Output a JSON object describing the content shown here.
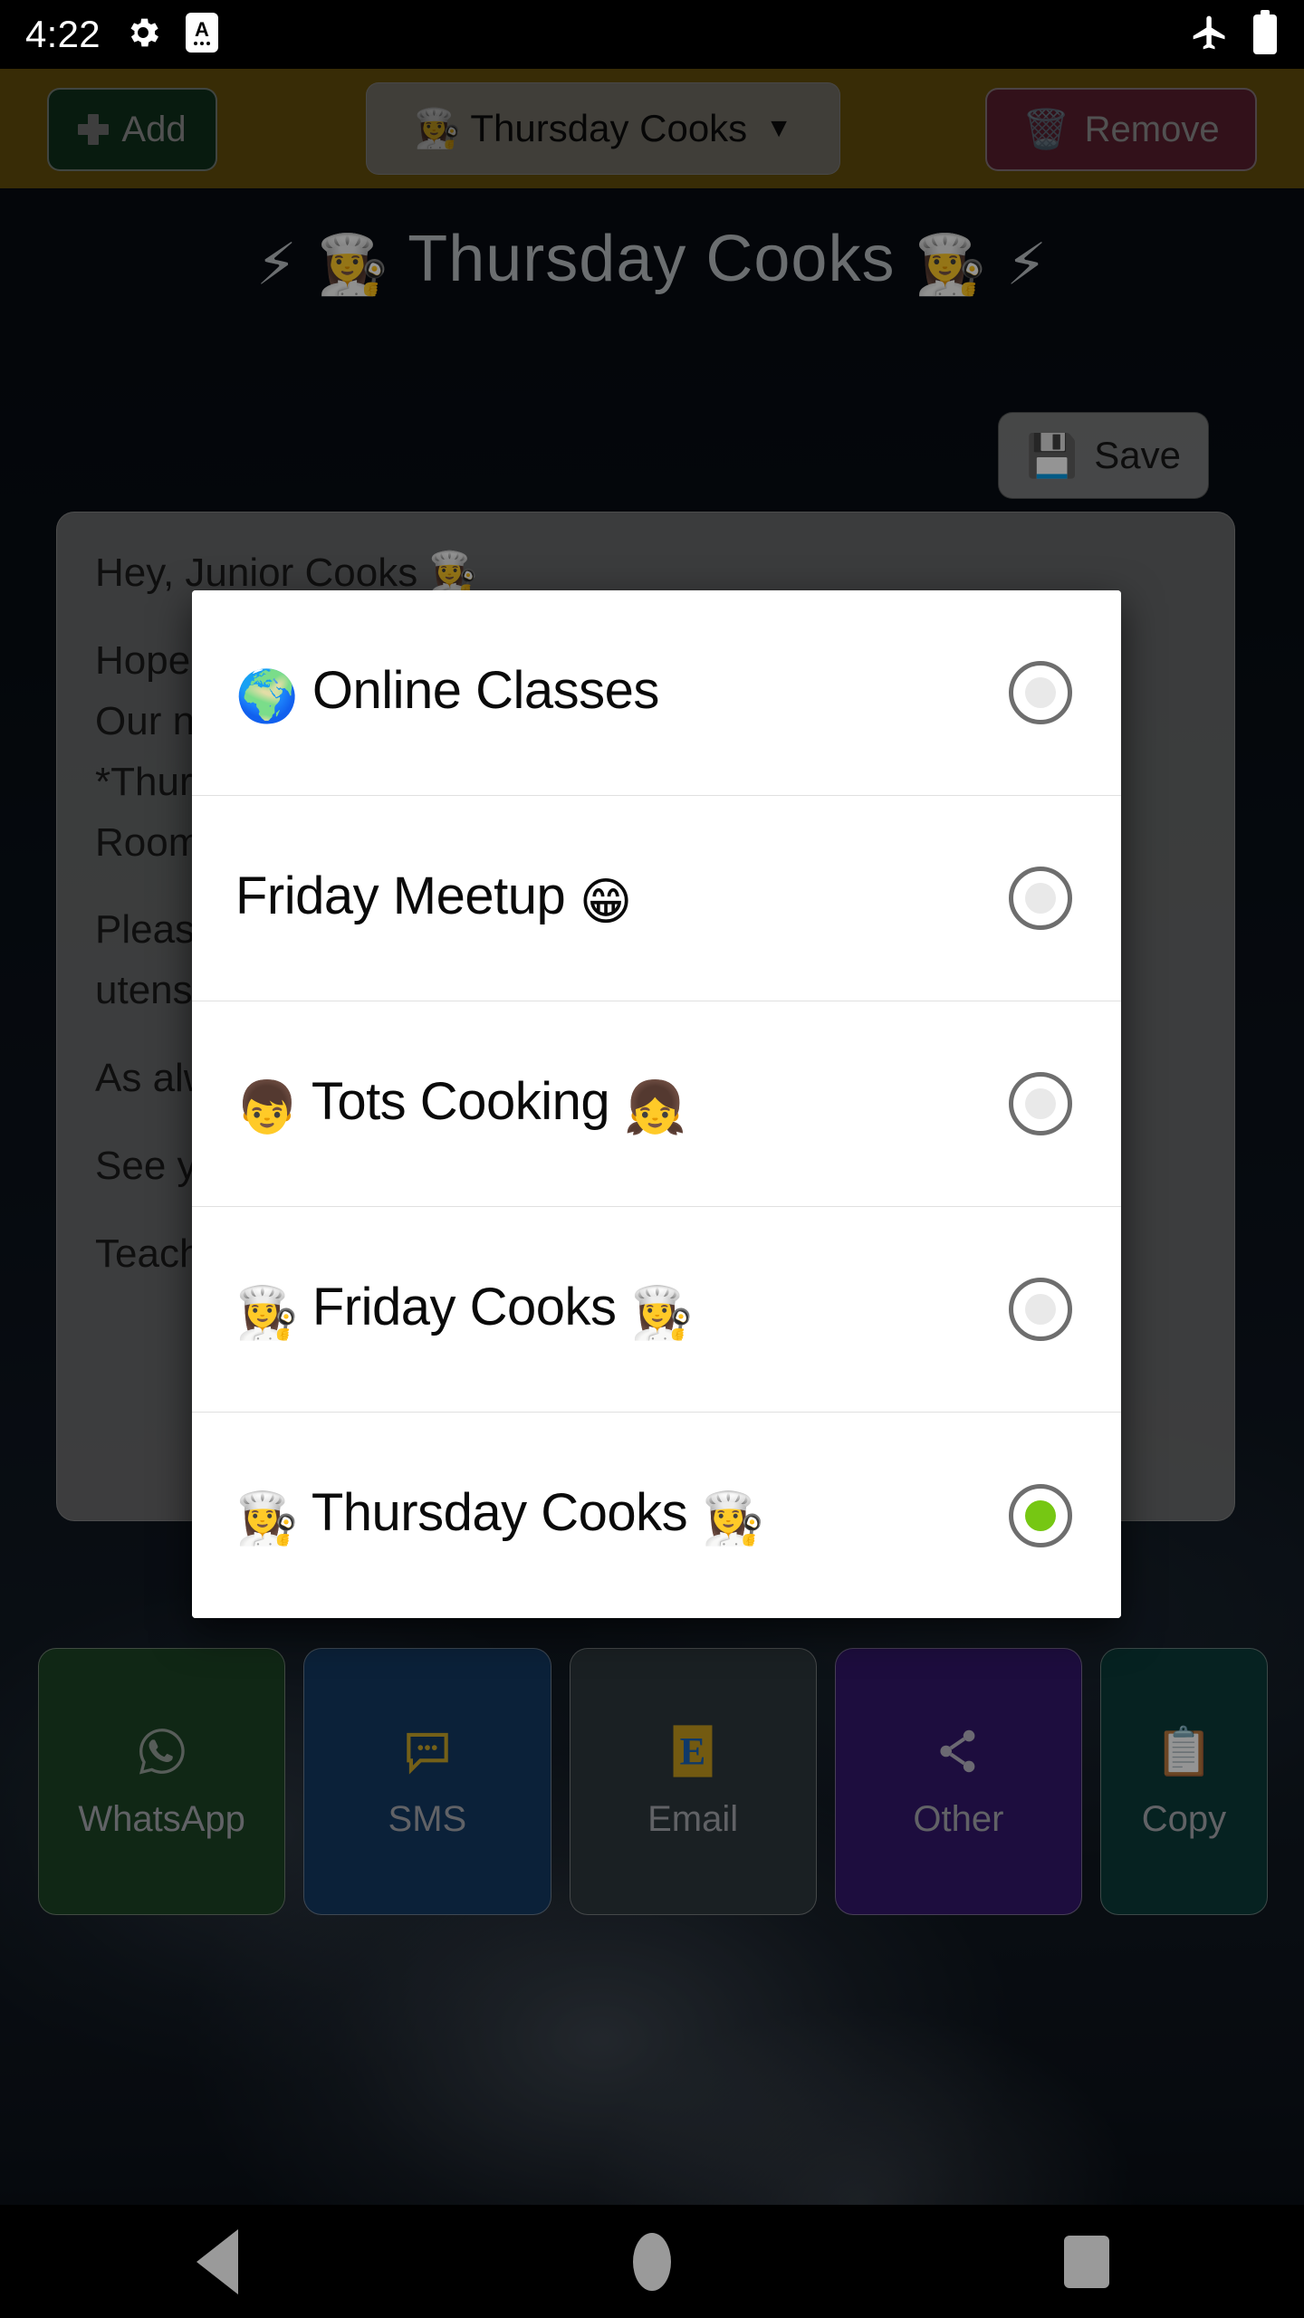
{
  "status_bar": {
    "clock": "4:22",
    "left_icons": [
      "gear-icon",
      "android-auto-icon"
    ],
    "right_icons": [
      "airplane-mode-icon",
      "battery-full-icon"
    ]
  },
  "toolbar": {
    "add_label": "Add",
    "group_selector_emoji": "👩‍🍳",
    "group_selector_label": "Thursday Cooks",
    "group_selector_caret": "▼",
    "remove_label": "Remove",
    "remove_emoji": "🗑️",
    "background_color": "#8c6d12"
  },
  "header": {
    "title_left_bolt": "⚡",
    "title_left_chef": "👩‍🍳",
    "title_text": "Thursday Cooks",
    "title_right_chef": "👩‍🍳",
    "title_right_bolt": "⚡"
  },
  "save_button": {
    "emoji": "💾",
    "label": "Save"
  },
  "message_card": {
    "lines": [
      "Hey, Junior Cooks 👩‍🍳",
      "Hope you're all doing great!",
      "Our next session is coming up.",
      "*Thursday Cooks* meets this week.",
      "Room 4 — see you there!",
      "Please remember to bring your own",
      "utensils and an apron.",
      "As always, snacks provided 👍",
      "See you soon!",
      "Teacher Sam"
    ]
  },
  "share_buttons": [
    {
      "name": "whatsapp",
      "label": "WhatsApp",
      "icon": "whatsapp-icon",
      "color": "#1d4425"
    },
    {
      "name": "sms",
      "label": "SMS",
      "icon": "chat-bubble-icon",
      "color": "#143963"
    },
    {
      "name": "email",
      "label": "Email",
      "icon": "envelope-icon",
      "color": "#2d383d"
    },
    {
      "name": "other",
      "label": "Other",
      "icon": "share-icon",
      "color": "#33176b"
    },
    {
      "name": "copy",
      "label": "Copy",
      "icon": "clipboard-icon",
      "color": "#0c3c39"
    }
  ],
  "dialog": {
    "selected_value": "Thursday Cooks",
    "options": [
      {
        "emoji_left": "🌍",
        "label": "Online Classes",
        "emoji_right": "",
        "selected": false
      },
      {
        "emoji_left": "",
        "label": "Friday Meetup",
        "emoji_right": "😁",
        "selected": false
      },
      {
        "emoji_left": "👦",
        "label": "Tots Cooking",
        "emoji_right": "👧",
        "selected": false
      },
      {
        "emoji_left": "👩‍🍳",
        "label": "Friday Cooks",
        "emoji_right": "👩‍🍳",
        "selected": false
      },
      {
        "emoji_left": "👩‍🍳",
        "label": "Thursday Cooks",
        "emoji_right": "👩‍🍳",
        "selected": true
      }
    ],
    "selected_radio_color": "#76c713"
  },
  "nav_bar": {
    "back": "back-button",
    "home": "home-button",
    "recents": "recents-button"
  }
}
